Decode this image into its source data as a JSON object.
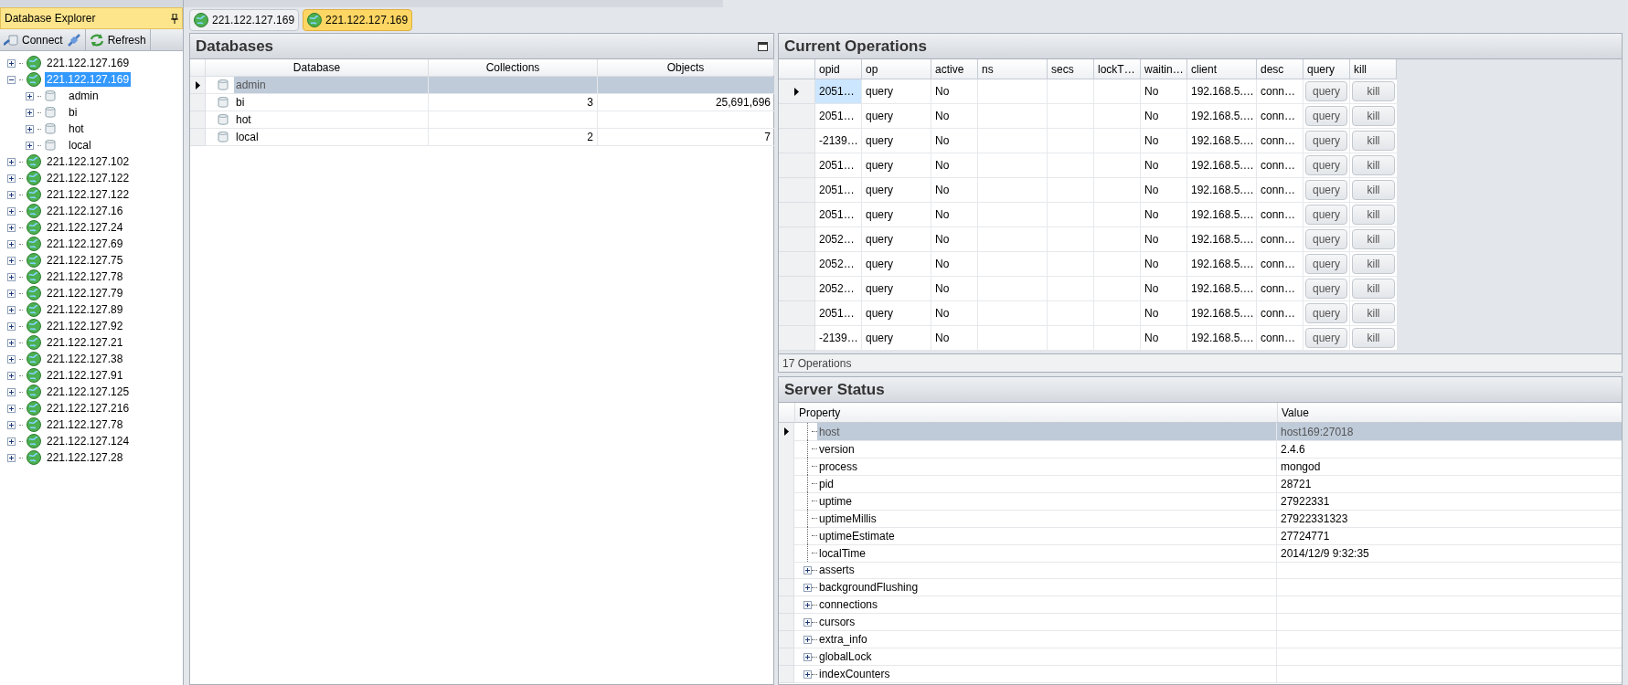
{
  "sidebar": {
    "title": "Database Explorer",
    "toolbar": [
      {
        "label": "Connect",
        "kind": "connect"
      },
      {
        "label": "Refresh",
        "kind": "refresh"
      }
    ],
    "tree": [
      {
        "label": "221.122.127.169",
        "expanded": false,
        "selected": false
      },
      {
        "label": "221.122.127.169",
        "expanded": true,
        "selected": true,
        "children": [
          {
            "label": "admin",
            "expanded": false,
            "selected": false
          },
          {
            "label": "bi",
            "expanded": false,
            "selected": false
          },
          {
            "label": "hot",
            "expanded": false,
            "selected": false
          },
          {
            "label": "local",
            "expanded": false,
            "selected": false
          }
        ]
      },
      {
        "label": "221.122.127.102",
        "expanded": false,
        "selected": false
      },
      {
        "label": "221.122.127.122",
        "expanded": false,
        "selected": false
      },
      {
        "label": "221.122.127.122",
        "expanded": false,
        "selected": false
      },
      {
        "label": "221.122.127.16",
        "expanded": false,
        "selected": false
      },
      {
        "label": "221.122.127.24",
        "expanded": false,
        "selected": false
      },
      {
        "label": "221.122.127.69",
        "expanded": false,
        "selected": false
      },
      {
        "label": "221.122.127.75",
        "expanded": false,
        "selected": false
      },
      {
        "label": "221.122.127.78",
        "expanded": false,
        "selected": false
      },
      {
        "label": "221.122.127.79",
        "expanded": false,
        "selected": false
      },
      {
        "label": "221.122.127.89",
        "expanded": false,
        "selected": false
      },
      {
        "label": "221.122.127.92",
        "expanded": false,
        "selected": false
      },
      {
        "label": "221.122.127.21",
        "expanded": false,
        "selected": false
      },
      {
        "label": "221.122.127.38",
        "expanded": false,
        "selected": false
      },
      {
        "label": "221.122.127.91",
        "expanded": false,
        "selected": false
      },
      {
        "label": "221.122.127.125",
        "expanded": false,
        "selected": false
      },
      {
        "label": "221.122.127.216",
        "expanded": false,
        "selected": false
      },
      {
        "label": "221.122.127.78",
        "expanded": false,
        "selected": false
      },
      {
        "label": "221.122.127.124",
        "expanded": false,
        "selected": false
      },
      {
        "label": "221.122.127.28",
        "expanded": false,
        "selected": false
      }
    ]
  },
  "doc_tabs": [
    {
      "label": "221.122.127.169",
      "selected": false
    },
    {
      "label": "221.122.127.169",
      "selected": true
    }
  ],
  "databases": {
    "title": "Databases",
    "columns": [
      "Database",
      "Collections",
      "Objects"
    ],
    "rows": [
      {
        "name": "admin",
        "selected": true
      },
      {
        "name": "bi",
        "collections": "3",
        "objects": "25,691,696",
        "selected": false
      },
      {
        "name": "hot",
        "selected": false
      },
      {
        "name": "local",
        "collections": "2",
        "objects": "7",
        "selected": false
      }
    ]
  },
  "operations": {
    "title": "Current Operations",
    "columns": [
      "opid",
      "op",
      "active",
      "ns",
      "secs",
      "lockT…",
      "waitin…",
      "client",
      "desc",
      "query",
      "kill"
    ],
    "rows": [
      {
        "opid": "2051…",
        "op": "query",
        "active": "No",
        "waiting": "No",
        "client": "192.168.5.…",
        "desc": "conn…",
        "query": "query",
        "kill": "kill",
        "selected": true
      },
      {
        "opid": "2051…",
        "op": "query",
        "active": "No",
        "waiting": "No",
        "client": "192.168.5.…",
        "desc": "conn…",
        "query": "query",
        "kill": "kill",
        "selected": false
      },
      {
        "opid": "-2139…",
        "op": "query",
        "active": "No",
        "waiting": "No",
        "client": "192.168.5.…",
        "desc": "conn…",
        "query": "query",
        "kill": "kill",
        "selected": false
      },
      {
        "opid": "2051…",
        "op": "query",
        "active": "No",
        "waiting": "No",
        "client": "192.168.5.…",
        "desc": "conn…",
        "query": "query",
        "kill": "kill",
        "selected": false
      },
      {
        "opid": "2051…",
        "op": "query",
        "active": "No",
        "waiting": "No",
        "client": "192.168.5.…",
        "desc": "conn…",
        "query": "query",
        "kill": "kill",
        "selected": false
      },
      {
        "opid": "2051…",
        "op": "query",
        "active": "No",
        "waiting": "No",
        "client": "192.168.5.…",
        "desc": "conn…",
        "query": "query",
        "kill": "kill",
        "selected": false
      },
      {
        "opid": "2052…",
        "op": "query",
        "active": "No",
        "waiting": "No",
        "client": "192.168.5.…",
        "desc": "conn…",
        "query": "query",
        "kill": "kill",
        "selected": false
      },
      {
        "opid": "2052…",
        "op": "query",
        "active": "No",
        "waiting": "No",
        "client": "192.168.5.…",
        "desc": "conn…",
        "query": "query",
        "kill": "kill",
        "selected": false
      },
      {
        "opid": "2052…",
        "op": "query",
        "active": "No",
        "waiting": "No",
        "client": "192.168.5.…",
        "desc": "conn…",
        "query": "query",
        "kill": "kill",
        "selected": false
      },
      {
        "opid": "2051…",
        "op": "query",
        "active": "No",
        "waiting": "No",
        "client": "192.168.5.…",
        "desc": "conn…",
        "query": "query",
        "kill": "kill",
        "selected": false
      },
      {
        "opid": "-2139…",
        "op": "query",
        "active": "No",
        "waiting": "No",
        "client": "192.168.5.…",
        "desc": "conn…",
        "query": "query",
        "kill": "kill",
        "selected": false
      }
    ],
    "footer": "17 Operations"
  },
  "server_status": {
    "title": "Server Status",
    "columns": [
      "Property",
      "Value"
    ],
    "rows": [
      {
        "kind": "leaf",
        "property": "host",
        "value": "host169:27018",
        "selected": true
      },
      {
        "kind": "leaf",
        "property": "version",
        "value": "2.4.6",
        "selected": false
      },
      {
        "kind": "leaf",
        "property": "process",
        "value": "mongod",
        "selected": false
      },
      {
        "kind": "leaf",
        "property": "pid",
        "value": "28721",
        "selected": false
      },
      {
        "kind": "leaf",
        "property": "uptime",
        "value": "27922331",
        "selected": false
      },
      {
        "kind": "leaf",
        "property": "uptimeMillis",
        "value": "27922331323",
        "selected": false
      },
      {
        "kind": "leaf",
        "property": "uptimeEstimate",
        "value": "27724771",
        "selected": false
      },
      {
        "kind": "leaf",
        "property": "localTime",
        "value": "2014/12/9 9:32:35",
        "selected": false
      },
      {
        "kind": "group",
        "property": "asserts",
        "selected": false
      },
      {
        "kind": "group",
        "property": "backgroundFlushing",
        "selected": false
      },
      {
        "kind": "group",
        "property": "connections",
        "selected": false
      },
      {
        "kind": "group",
        "property": "cursors",
        "selected": false
      },
      {
        "kind": "group",
        "property": "extra_info",
        "selected": false
      },
      {
        "kind": "group",
        "property": "globalLock",
        "selected": false
      },
      {
        "kind": "group",
        "property": "indexCounters",
        "selected": false
      }
    ]
  }
}
